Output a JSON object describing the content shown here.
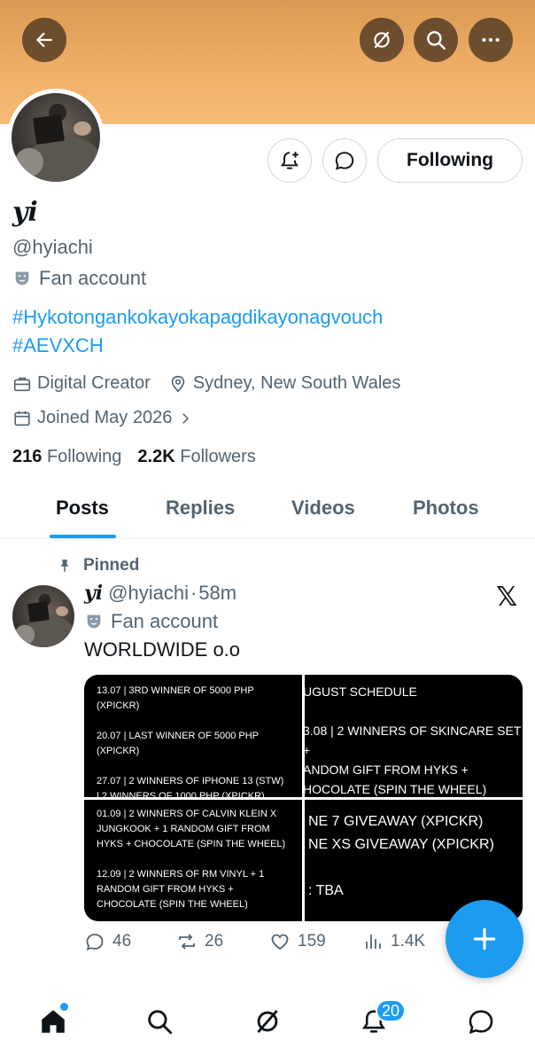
{
  "header": {
    "icons": [
      "back-arrow-icon",
      "grok-icon",
      "search-icon",
      "more-icon"
    ]
  },
  "profile": {
    "display_name": "yi",
    "handle": "@hyiachi",
    "category": "Fan account",
    "bio_line1": "#Hykotongankokayokapagdikayonagvouch",
    "bio_line2": "#AEVXCH",
    "profession": "Digital Creator",
    "location": "Sydney, New South Wales",
    "joined": "Joined May 2026",
    "following_count": "216",
    "following_label": "Following",
    "followers_count": "2.2K",
    "followers_label": "Followers",
    "follow_button": "Following"
  },
  "tabs": [
    {
      "label": "Posts",
      "active": true
    },
    {
      "label": "Replies",
      "active": false
    },
    {
      "label": "Videos",
      "active": false
    },
    {
      "label": "Photos",
      "active": false
    }
  ],
  "post": {
    "pinned_label": "Pinned",
    "name": "yi",
    "handle": "@hyiachi",
    "separator": "·",
    "time": "58m",
    "category": "Fan account",
    "text": "WORLDWIDE o.o",
    "images": [
      "13.07 | 3RD WINNER OF 5000 PHP\n(XPICKR)\n\n20.07 | LAST WINNER OF 5000 PHP\n(XPICKR)\n\n27.07 | 2 WINNERS OF IPHONE 13 (STW)\n        | 2 WINNERS OF 1000 PHP (XPICKR)",
      "UGUST SCHEDULE\n\n3.08 | 2 WINNERS OF SKINCARE SET +\nANDOM GIFT FROM HYKS +\nHOCOLATE (SPIN THE WHEEL)",
      "01.09 | 2 WINNERS OF CALVIN KLEIN X\nJUNGKOOK + 1 RANDOM GIFT FROM\nHYKS + CHOCOLATE (SPIN THE WHEEL)\n\n12.09 | 2 WINNERS OF RM VINYL + 1\nRANDOM GIFT FROM HYKS +\nCHOCOLATE (SPIN THE WHEEL)",
      "NE 7 GIVEAWAY (XPICKR)\nNE XS GIVEAWAY (XPICKR)\n\n: TBA"
    ],
    "replies": "46",
    "reposts": "26",
    "likes": "159",
    "views": "1.4K"
  },
  "nav": {
    "items": [
      "home-icon",
      "search-icon",
      "grok-icon",
      "notifications-icon",
      "messages-icon"
    ],
    "notification_badge": "20"
  },
  "colors": {
    "accent": "#1d9bf0",
    "banner": "#efae65",
    "text": "#0f1419",
    "secondary": "#536471"
  }
}
